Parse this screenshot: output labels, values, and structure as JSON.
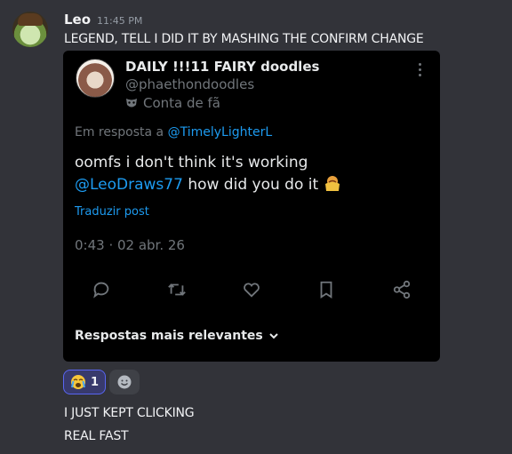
{
  "message": {
    "username": "Leo",
    "timestamp": "11:45 PM",
    "lines": [
      "LEGEND, TELL I DID IT BY MASHING THE CONFIRM CHANGE",
      "I JUST KEPT CLICKING",
      "REAL FAST"
    ]
  },
  "embed": {
    "display_name": "DAILY !!!11 FAIRY doodles",
    "handle": "@phaethondoodles",
    "badge": "Conta de fã",
    "reply_prefix": "Em resposta a ",
    "reply_mention": "@TimelyLighterL",
    "text_line1": "oomfs i don't think it's working",
    "text_mention": "@LeoDraws77",
    "text_line2": " how did you do it",
    "translate_label": "Traduzir post",
    "date": "0:43 · 02 abr. 26",
    "actions": [
      "reply-icon",
      "retweet-icon",
      "like-icon",
      "bookmark-icon",
      "share-icon"
    ],
    "relevant_label": "Respostas mais relevantes"
  },
  "reactions": [
    {
      "icon": "crying-face-emoji",
      "count": "1"
    }
  ],
  "colors": {
    "background": "#323339",
    "embed_bg": "#000000",
    "link_blue": "#1d9bf0",
    "reaction_border": "#5865f2"
  }
}
